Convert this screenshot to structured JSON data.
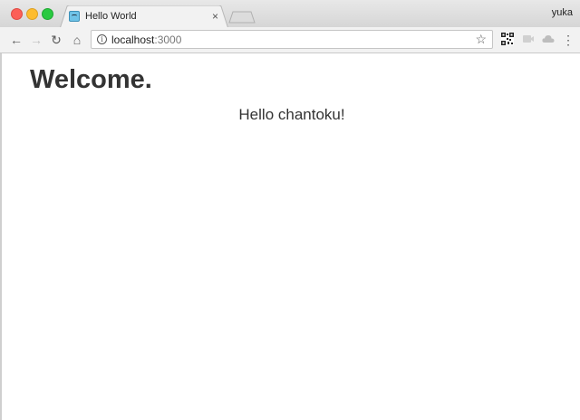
{
  "browser": {
    "tab": {
      "title": "Hello World",
      "close_glyph": "×",
      "favicon": "gopher-favicon-icon"
    },
    "profile_name": "yuka",
    "address_bar": {
      "host": "localhost",
      "port": ":3000"
    },
    "icons": {
      "back": "←",
      "forward": "→",
      "reload": "↻",
      "home": "⌂",
      "info": "i",
      "star": "☆",
      "menu": "⋮"
    },
    "colors": {
      "close": "#fc5f57",
      "minimize": "#fdbc2e",
      "maximize": "#29c940"
    }
  },
  "page": {
    "heading": "Welcome.",
    "greeting": "Hello chantoku!"
  }
}
